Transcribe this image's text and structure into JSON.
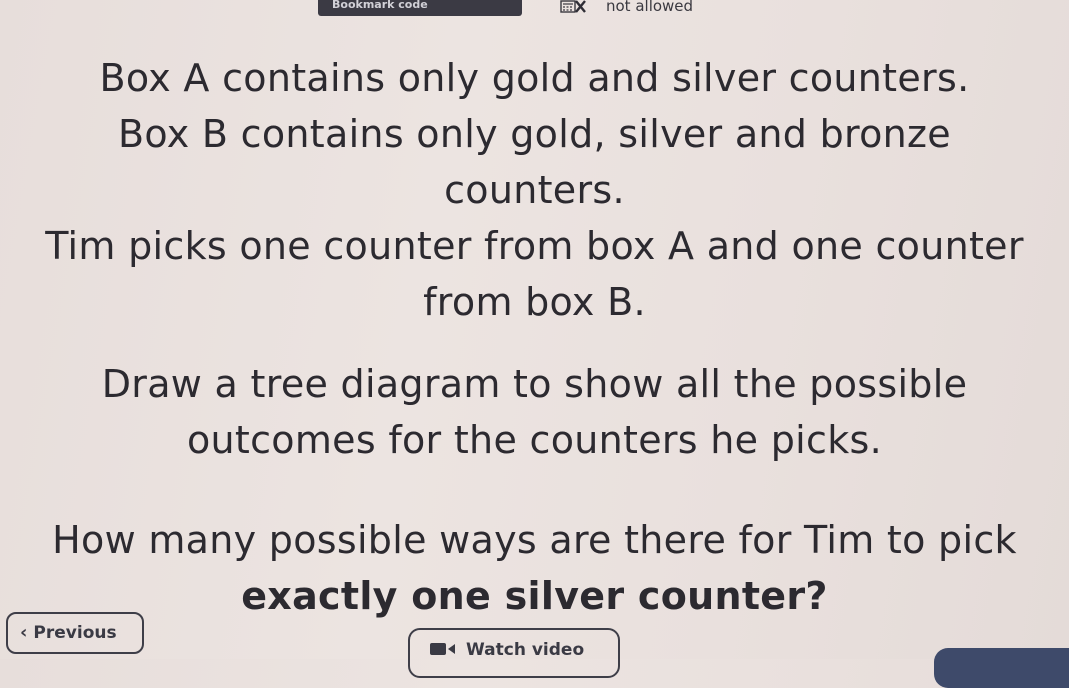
{
  "top_bar": {
    "bookmark_text": "Bookmark code",
    "calculator_icon": "calculator-crossed-icon",
    "calculator_status": "not allowed"
  },
  "question": {
    "block1": [
      "Box A contains only gold and silver counters.",
      "Box B contains only gold, silver and bronze",
      "counters.",
      "Tim picks one counter from box A and one counter",
      "from box B."
    ],
    "block2": [
      "Draw a tree diagram to show all the possible",
      "outcomes for the counters he picks."
    ],
    "block3_line1": "How many possible ways are there for Tim to pick",
    "block3_line2": "exactly one silver counter?"
  },
  "nav": {
    "previous_label": "Previous",
    "previous_icon": "chevron-left-icon",
    "watch_video_label": "Watch video",
    "watch_video_icon": "video-camera-icon"
  },
  "colors": {
    "background": "#e9e0dd",
    "text": "#2c2a30",
    "button_border": "#3e3e48",
    "dark_pill": "#3b3a44"
  }
}
